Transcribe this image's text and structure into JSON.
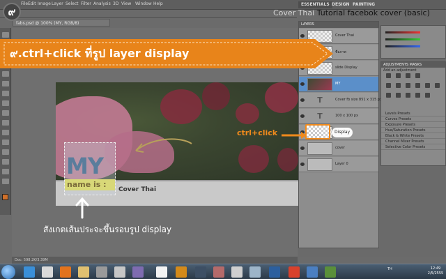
{
  "step": {
    "number": "๙"
  },
  "banner": {
    "text": "๙.ctrl+click ที่รูป layer display"
  },
  "top_right_title": {
    "prefix": "Cover Thai",
    "main": "Tutorial facebok cover (basic)"
  },
  "photoshop": {
    "menu": [
      "File",
      "Edit",
      "Image",
      "Layer",
      "Select",
      "Filter",
      "Analysis",
      "3D",
      "View",
      "Window",
      "Help"
    ],
    "workspaces": [
      "ESSENTIALS",
      "DESIGN",
      "PAINTING"
    ],
    "document_tab": "fabs.psd @ 100% (MY, RGB/8)",
    "status": "Doc: 598.2K/3.39M",
    "layers_header": "LAYERS",
    "layers": [
      {
        "name": "Cover Thai",
        "thumb": "check"
      },
      {
        "name": "ชื่อภาพ",
        "thumb": "check"
      },
      {
        "name": "slide Display",
        "thumb": "check"
      },
      {
        "name": "MY",
        "thumb": "image",
        "selected": true
      },
      {
        "name": "Cover fb size 851 x 315 px",
        "thumb": "text"
      },
      {
        "name": "100 x 100 px",
        "thumb": "text"
      },
      {
        "name": "Display",
        "thumb": "check"
      },
      {
        "name": "cover",
        "thumb": "gray"
      },
      {
        "name": "Layer 0",
        "thumb": "gray"
      }
    ],
    "adjustments_header": "ADJUSTMENTS  MASKS",
    "adjustments_hint": "Add an adjustment",
    "presets": [
      "Levels Presets",
      "Curves Presets",
      "Exposure Presets",
      "Hue/Saturation Presets",
      "Black & White Presets",
      "Channel Mixer Presets",
      "Selective Color Presets"
    ]
  },
  "document": {
    "cover_text": "Cover Thai",
    "logo_big": "MY",
    "logo_small": "name is :"
  },
  "callout": {
    "ctrl_click": "ctrl+click",
    "display_label": "Display"
  },
  "note": {
    "text": "สังเกตเส้นประจะขึ้นรอบรูป display"
  },
  "taskbar": {
    "lang": "TH",
    "time": "12:49",
    "date": "2/5/2555"
  },
  "colors": {
    "accent": "#f08a1c",
    "banner": "#e8841a",
    "selected_layer": "#5b8fc9"
  }
}
